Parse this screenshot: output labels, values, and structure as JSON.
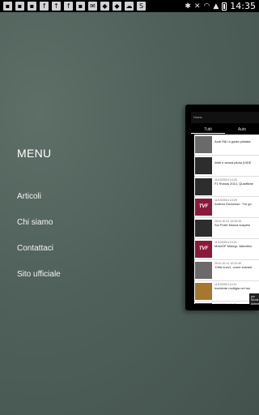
{
  "status_bar": {
    "time": "14:35",
    "left_icons": [
      "bbm-icon",
      "notification-icon",
      "gallery-icon",
      "facebook-icon",
      "upload-icon",
      "facebook-icon",
      "flipboard-icon",
      "email-icon",
      "dropbox-icon",
      "dropbox-icon",
      "cloud-icon",
      "skype-icon"
    ],
    "left_glyphs": [
      "▪",
      "▪",
      "▪",
      "f",
      "↑",
      "f",
      "▪",
      "✉",
      "◆",
      "◆",
      "☁",
      "S"
    ]
  },
  "drawer": {
    "title": "MENU",
    "items": [
      {
        "label": "Articoli"
      },
      {
        "label": "Chi siamo"
      },
      {
        "label": "Contattaci"
      },
      {
        "label": "Sito ufficiale"
      }
    ]
  },
  "preview": {
    "action_bar": "Home",
    "tabs": [
      "Tutti",
      "Auto"
    ],
    "rows": [
      {
        "date": "",
        "text": "Audi R8J a guida pilotata",
        "thumb": "grey"
      },
      {
        "date": "",
        "text": "limiti e senza pilota (VIDE",
        "thumb": "dark"
      },
      {
        "date": "11/10/2014 14:23",
        "text": "F1 Russia 2014, Qualifiche",
        "thumb": "dark"
      },
      {
        "date": "11/10/2014 13:29",
        "text": "Andrea Dovizioso: \"Ho go",
        "thumb": "tvf"
      },
      {
        "date": "2014-10-11 13:20:43",
        "text": "Sul Porte Mosca sospesi",
        "thumb": "dark"
      },
      {
        "date": "11/10/2014 13:21",
        "text": "MotoGP Motegi, Valentino",
        "thumb": "tvf"
      },
      {
        "date": "2014-10-11 12:22:40",
        "text": "'Città nuovi', come salvare",
        "thumb": "grey"
      },
      {
        "date": "11/10/2014 12:11",
        "text": "Incidente multigia nel tun",
        "thumb": "brown"
      },
      {
        "date": "11/10/2014 11:28",
        "text": "MotoGP Motegi, Marc Mar",
        "thumb": "tvf"
      }
    ],
    "tvf_label": "TVF",
    "toast": "per Nicola Antenelli, Il tutto, l'attuale Magazin"
  }
}
